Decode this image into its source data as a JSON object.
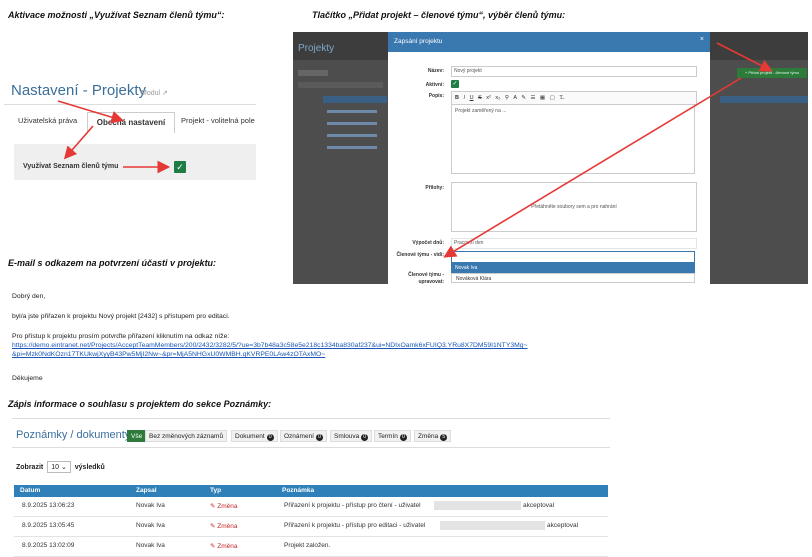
{
  "captions": {
    "c1": "Aktivace možnosti „Využívat Seznam členů týmu“:",
    "c2": "Tlačítko „Přidat projekt – členové týmu“, výběr členů týmu:",
    "c3": "E-mail s odkazem na potvrzení účasti v projektu:",
    "c4": "Zápis informace o souhlasu s projektem do sekce Poznámky:"
  },
  "nastaveni": {
    "title": "Nastavení - Projekty",
    "modul": "Modul",
    "tabs": [
      "Uživatelská práva",
      "Obecná nastavení",
      "Projekt - volitelná pole"
    ],
    "option_label": "Využívat Seznam členů týmu"
  },
  "app": {
    "title": "Projekty",
    "green_button": "+ Přidat projekt - členové týmu",
    "modal_title": "Zapsání projektu",
    "labels": {
      "nazev": "Název:",
      "aktivni": "Aktivní:",
      "popis": "Popis:",
      "prilohy": "Přílohy:",
      "vypocet": "Výpočet dnů:",
      "clenove_vidi": "Členové týmu - vidí:",
      "clenove_upravovat": "Členové týmu - upravovat:"
    },
    "nazev_value": "Nový projekt",
    "popis_value": "Projekt zaměřený na ...",
    "drop_text": "Přetáhněte soubory sem a pro nahrání",
    "vypocet_value": "Pracovní den",
    "options": [
      "Novak Iva",
      "Nováková Klára"
    ]
  },
  "email": {
    "greeting": "Dobrý den,",
    "line1": "byl/a jste přiřazen k projektu Nový projekt [2432] s přístupem pro editaci.",
    "line2": "Pro přístup k projektu prosím potvrďte přiřazení kliknutím na odkaz níže:",
    "link1": "https://demo.eintranet.net/Projects/AcceptTeamMembers/200/2432/3282/5/?ue=3b7b48a3c58e5e218c1334ba830af237&ui=NDIxOamk6xFUIQ3.YRu8X7DM59I1NTY3Mg~",
    "link2": "&pi=Mzk0NdKOzn17TKUkwjXyyB43Pw5MjI2Nw~&pr=MjA5NHGxU0WMBH.qKVRPE0LAw4zOTAxMO~",
    "thanks": "Děkujeme"
  },
  "poznamky": {
    "title": "Poznámky / dokumenty",
    "filters": [
      {
        "label": "Vše",
        "count": null,
        "active": true
      },
      {
        "label": "Bez změnových záznamů",
        "count": null,
        "active": false
      },
      {
        "label": "Dokument",
        "count": "0",
        "active": false
      },
      {
        "label": "Oznámení",
        "count": "0",
        "active": false
      },
      {
        "label": "Smlouva",
        "count": "0",
        "active": false
      },
      {
        "label": "Termín",
        "count": "0",
        "active": false
      },
      {
        "label": "Změna",
        "count": "5",
        "active": false
      }
    ],
    "show_prefix": "Zobrazit",
    "show_value": "10",
    "show_suffix": "výsledků",
    "columns": [
      "Datum",
      "Zapsal",
      "Typ",
      "Poznámka"
    ],
    "rows": [
      {
        "datum": "8.9.2025 13:06:23",
        "zapsal": "Novak Iva",
        "typ": "Změna",
        "pozn_a": "Přiřazení k projektu - přístup pro čtení - uživatel",
        "pozn_b": "akceptoval"
      },
      {
        "datum": "8.9.2025 13:05:45",
        "zapsal": "Novak Iva",
        "typ": "Změna",
        "pozn_a": "Přiřazení k projektu - přístup pro editaci - uživatel",
        "pozn_b": "akceptoval"
      },
      {
        "datum": "8.9.2025 13:02:09",
        "zapsal": "Novak Iva",
        "typ": "Změna",
        "pozn_a": "Projekt založen.",
        "pozn_b": ""
      }
    ]
  },
  "colors": {
    "accent_blue": "#3a78b0",
    "green": "#2d7a3a",
    "arrow_red": "#e53935"
  }
}
